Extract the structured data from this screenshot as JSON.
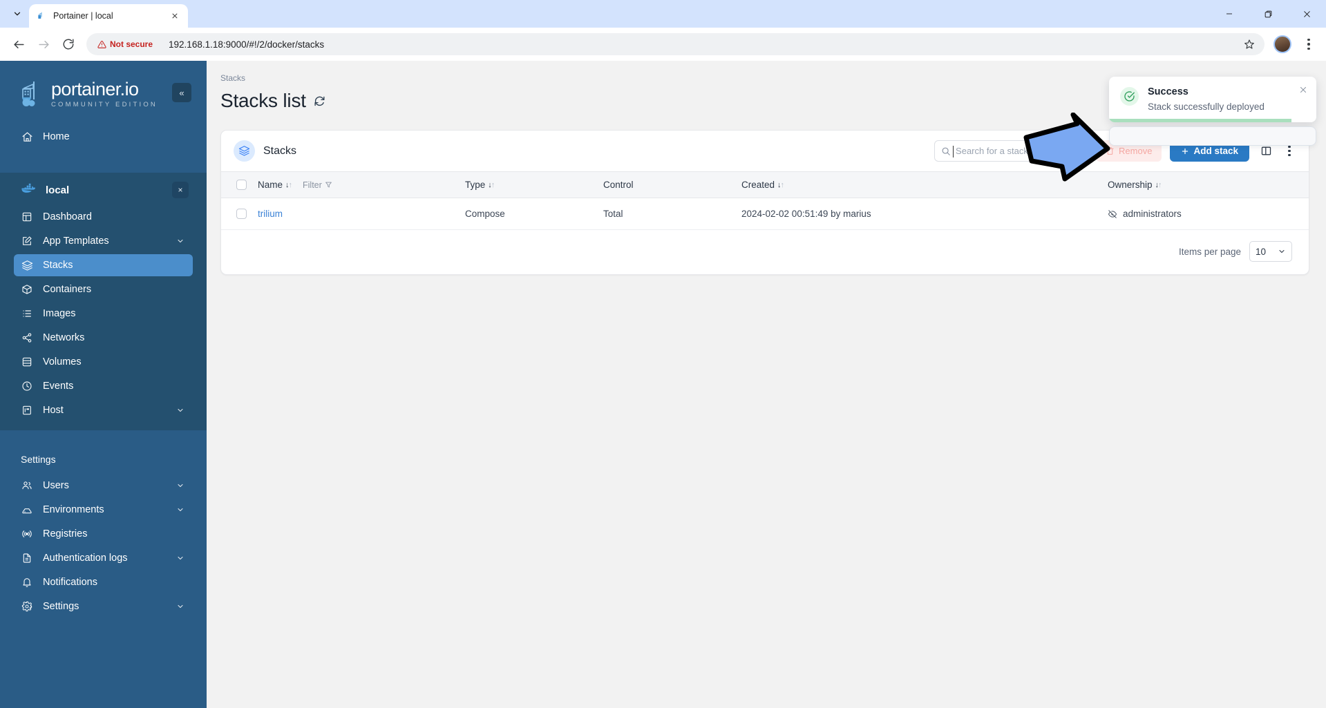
{
  "browser": {
    "tab": {
      "title": "Portainer | local",
      "favicon_icon": "portainer-favicon"
    },
    "tab_list_icon": "chevron-down-icon",
    "tab_close_icon": "close-icon",
    "window_minimize_icon": "minimize-icon",
    "window_maximize_icon": "maximize-icon",
    "window_close_icon": "close-icon",
    "back_icon": "arrow-left-icon",
    "forward_icon": "arrow-right-icon",
    "reload_icon": "reload-icon",
    "security_label": "Not secure",
    "security_icon": "warning-triangle-icon",
    "url": "192.168.1.18:9000/#!/2/docker/stacks",
    "bookmark_icon": "star-icon",
    "profile_icon": "avatar",
    "menu_icon": "kebab-menu-icon"
  },
  "sidebar": {
    "logo_name": "portainer.io",
    "logo_sub": "COMMUNITY EDITION",
    "logo_icon": "portainer-logo-icon",
    "collapse_label": "«",
    "home": {
      "label": "Home",
      "icon": "home-icon"
    },
    "environment": {
      "name": "local",
      "icon": "docker-icon",
      "close_label": "×"
    },
    "env_items": [
      {
        "label": "Dashboard",
        "icon": "dashboard-icon",
        "chevron": false,
        "active": false
      },
      {
        "label": "App Templates",
        "icon": "template-icon",
        "chevron": true,
        "active": false
      },
      {
        "label": "Stacks",
        "icon": "stacks-icon",
        "chevron": false,
        "active": true
      },
      {
        "label": "Containers",
        "icon": "containers-icon",
        "chevron": false,
        "active": false
      },
      {
        "label": "Images",
        "icon": "images-icon",
        "chevron": false,
        "active": false
      },
      {
        "label": "Networks",
        "icon": "networks-icon",
        "chevron": false,
        "active": false
      },
      {
        "label": "Volumes",
        "icon": "volumes-icon",
        "chevron": false,
        "active": false
      },
      {
        "label": "Events",
        "icon": "events-clock-icon",
        "chevron": false,
        "active": false
      },
      {
        "label": "Host",
        "icon": "host-icon",
        "chevron": true,
        "active": false
      }
    ],
    "settings_title": "Settings",
    "settings_items": [
      {
        "label": "Users",
        "icon": "users-icon",
        "chevron": true
      },
      {
        "label": "Environments",
        "icon": "environments-icon",
        "chevron": true
      },
      {
        "label": "Registries",
        "icon": "registries-icon",
        "chevron": false
      },
      {
        "label": "Authentication logs",
        "icon": "document-icon",
        "chevron": true
      },
      {
        "label": "Notifications",
        "icon": "bell-icon",
        "chevron": false
      },
      {
        "label": "Settings",
        "icon": "gear-icon",
        "chevron": true
      }
    ]
  },
  "main": {
    "breadcrumb": "Stacks",
    "page_title": "Stacks list",
    "refresh_icon": "refresh-icon",
    "card": {
      "title": "Stacks",
      "title_icon": "stacks-icon",
      "search_placeholder": "Search for a stack...",
      "search_value": "",
      "search_icon": "search-icon",
      "remove_label": "Remove",
      "remove_icon": "trash-icon",
      "add_label": "Add stack",
      "add_icon": "plus-icon",
      "columns_icon": "columns-layout-icon",
      "more_icon": "kebab-menu-icon"
    },
    "table": {
      "filter_label": "Filter",
      "filter_icon": "funnel-icon",
      "columns": [
        {
          "label": "Name",
          "sortable": true
        },
        {
          "label": "Type",
          "sortable": true
        },
        {
          "label": "Control",
          "sortable": false
        },
        {
          "label": "Created",
          "sortable": true
        },
        {
          "label": "Ownership",
          "sortable": true
        }
      ],
      "rows": [
        {
          "name": "trilium",
          "type": "Compose",
          "control": "Total",
          "created": "2024-02-02 00:51:49 by marius",
          "ownership": "administrators",
          "ownership_icon": "eye-off-icon"
        }
      ]
    },
    "footer": {
      "items_per_page_label": "Items per page",
      "items_per_page_value": "10",
      "chevron_icon": "chevron-down-icon"
    }
  },
  "toast": {
    "title": "Success",
    "message": "Stack successfully deployed",
    "icon": "check-circle-icon",
    "close_icon": "close-icon",
    "progress_percent": 88,
    "accent_color": "#a9dfbd"
  },
  "annotation": {
    "arrow_icon": "blue-right-arrow",
    "fill_color": "#7aa8f2",
    "stroke_color": "#000000"
  }
}
